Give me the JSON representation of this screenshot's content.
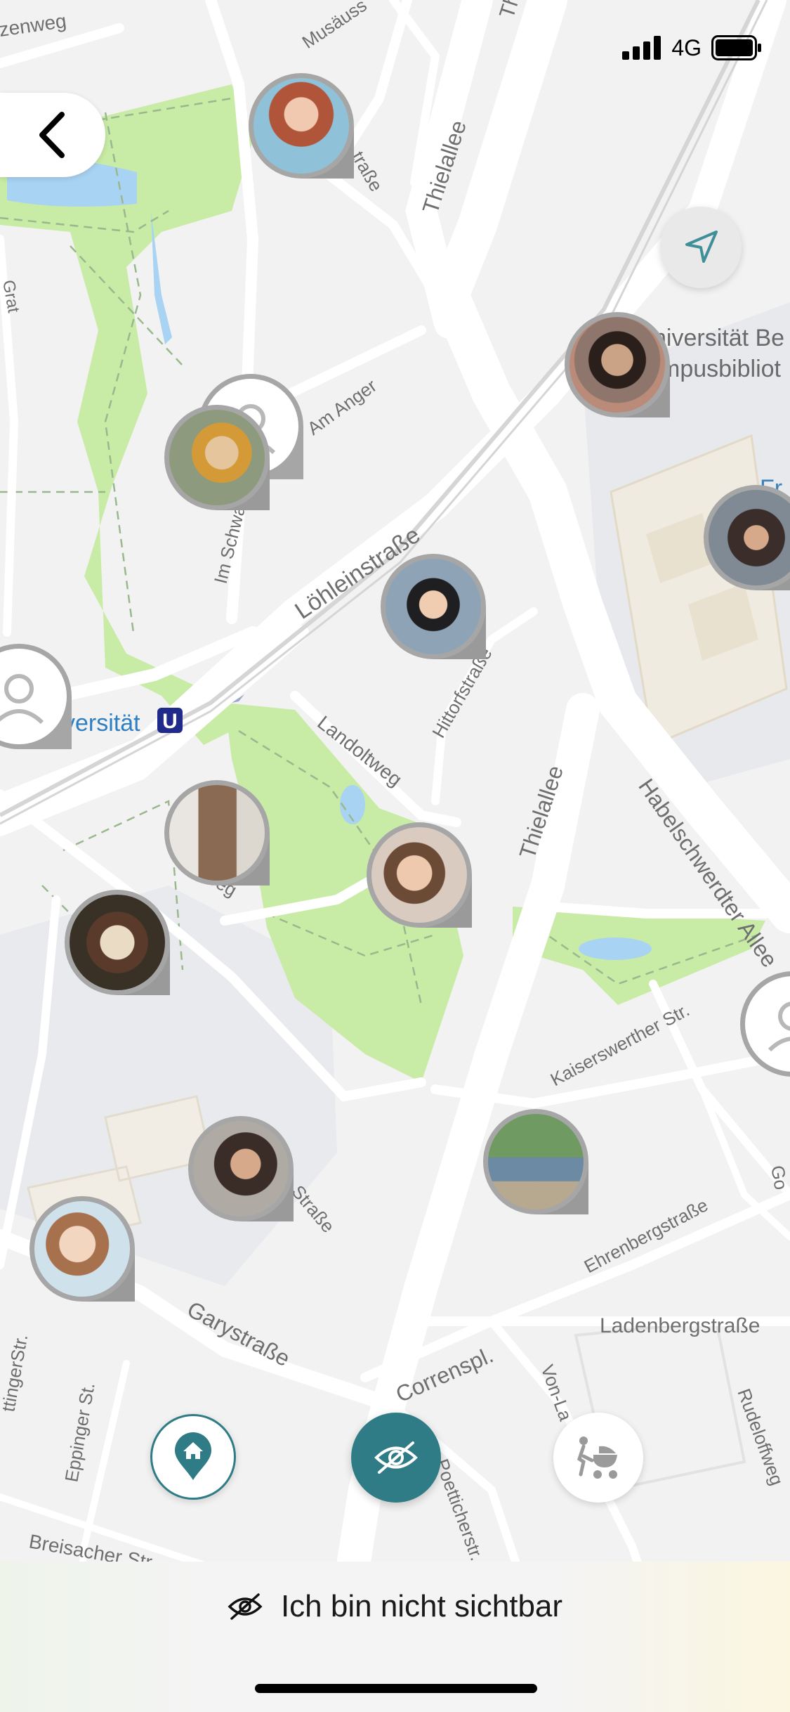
{
  "status_bar": {
    "network": "4G"
  },
  "map": {
    "streets": [
      {
        "text": "zenweg"
      },
      {
        "text": "Musäuss"
      },
      {
        "text": "Th"
      },
      {
        "text": "Thielallee"
      },
      {
        "text": "Am Anger"
      },
      {
        "text": "Im Schwa"
      },
      {
        "text": "Löhleinstraße"
      },
      {
        "text": "Hittorfstraße"
      },
      {
        "text": "Landoltweg"
      },
      {
        "text": "Thielallee"
      },
      {
        "text": "Habelschwerdter Allee"
      },
      {
        "text": "yweg"
      },
      {
        "text": "Kaiserswerther Str."
      },
      {
        "text": "Straße"
      },
      {
        "text": "Ehrenbergstraße"
      },
      {
        "text": "Ladenbergstraße"
      },
      {
        "text": "Garystraße"
      },
      {
        "text": "Correnspl."
      },
      {
        "text": "Von-La"
      },
      {
        "text": "Rudeloffweg"
      },
      {
        "text": "Eppinger St."
      },
      {
        "text": "Breisacher Str."
      },
      {
        "text": "ttingerStr."
      },
      {
        "text": "Poetticherstr."
      },
      {
        "text": "Go"
      },
      {
        "text": "Grat"
      },
      {
        "text": "traße"
      },
      {
        "text": "Fr"
      }
    ],
    "poi": {
      "university_library_1": "niversität Be",
      "university_library_2": "mpusbibliot",
      "subway_station": "versität",
      "subway_badge": "U"
    }
  },
  "bottom_bar": {
    "visibility_label": "Ich bin nicht sichtbar"
  },
  "colors": {
    "accent": "#2f7c86",
    "park": "#c8eba6",
    "water": "#a9d3f2",
    "road": "#ffffff",
    "background": "#f2f2f2"
  }
}
